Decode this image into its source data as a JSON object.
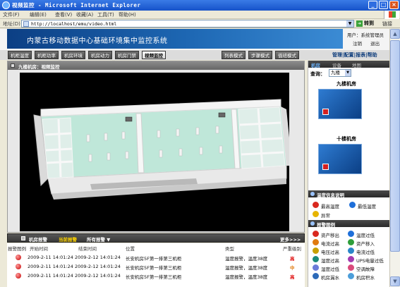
{
  "window": {
    "title": "视频监控 - Microsoft Internet Explorer",
    "controls": [
      "_",
      "□",
      "×"
    ]
  },
  "menubar": {
    "items": [
      "文件(F)",
      "编辑(E)",
      "查看(V)",
      "收藏(A)",
      "工具(T)",
      "帮助(H)"
    ]
  },
  "addressbar": {
    "label": "地址(D)",
    "url": "http://localhost/emu/video.html",
    "go_label": "转到",
    "links_label": "链接"
  },
  "header": {
    "system_title": "内蒙古移动数据中心基础环境集中监控系统",
    "user_text": "用户：系统管理员",
    "logout_items": [
      "注销",
      "退出"
    ]
  },
  "nav": {
    "tabs": [
      {
        "label": "机柜温度",
        "active": false
      },
      {
        "label": "机柜功率",
        "active": false
      },
      {
        "label": "机房环境",
        "active": false
      },
      {
        "label": "机房动力",
        "active": false
      },
      {
        "label": "机房门禁",
        "active": false
      },
      {
        "label": "视频监控",
        "active": true
      }
    ],
    "modes": [
      "列表模式",
      "步骤模式",
      "值班模式"
    ],
    "management_links": "管理|配置|报表|帮助"
  },
  "main": {
    "breadcrumb": "九楼机房：视频监控"
  },
  "alarms": {
    "bar": {
      "title": "机房报警",
      "current": "当前报警",
      "all": "所有报警 ▼",
      "more": "更多>>>"
    },
    "columns": [
      "报警图例",
      "开始时间",
      "结束时间",
      "位置",
      "类型",
      "严重级别"
    ],
    "rows": [
      {
        "start": "2009-2-11 14:01:24",
        "end": "2009-2-12 14:01:24",
        "location": "长安机房5F第一排第三机柜",
        "type": "温度报警，温度38度",
        "severity": "高",
        "severity_color": "#e01818"
      },
      {
        "start": "2009-2-11 14:01:24",
        "end": "2009-2-12 14:01:24",
        "location": "长安机房5F第一排第三机柜",
        "type": "温度报警，温度38度",
        "severity": "中",
        "severity_color": "#e07b10"
      },
      {
        "start": "2009-2-11 14:01:24",
        "end": "2009-2-12 14:01:24",
        "location": "长安机房5F第一排第三机柜",
        "type": "温度报警，温度38度",
        "severity": "高",
        "severity_color": "#e01818"
      }
    ]
  },
  "sidebar": {
    "tabs": [
      "机房",
      "设备",
      "地图"
    ],
    "query_label": "查询：",
    "query_value": "九楼",
    "rooms": [
      {
        "name": "九楼机房"
      },
      {
        "name": "十楼机房"
      }
    ],
    "temp_legend": {
      "title": "温度信息说明",
      "items": [
        {
          "label": "最高温度",
          "color": "#d9281e"
        },
        {
          "label": "最低温度",
          "color": "#1e6fd9"
        },
        {
          "label": "异常",
          "color": "#e6b400"
        }
      ]
    },
    "alarm_legend": {
      "title": "报警图例",
      "items": [
        {
          "label": "资产移出",
          "color": "#d9281e"
        },
        {
          "label": "温度过低",
          "color": "#1e6fd9"
        },
        {
          "label": "电流过高",
          "color": "#e07b10"
        },
        {
          "label": "资产移入",
          "color": "#2e9e3a"
        },
        {
          "label": "电压过高",
          "color": "#c8a000"
        },
        {
          "label": "电流过低",
          "color": "#2a86c9"
        },
        {
          "label": "湿度过高",
          "color": "#1b8a7a"
        },
        {
          "label": "UPS电量过低",
          "color": "#a33bb0"
        },
        {
          "label": "湿度过低",
          "color": "#6c7bd9"
        },
        {
          "label": "空调故障",
          "color": "#d94a7b"
        },
        {
          "label": "机房漏水",
          "color": "#2d6ab8"
        },
        {
          "label": "机房积水",
          "color": "#4c9ed9"
        }
      ]
    }
  }
}
